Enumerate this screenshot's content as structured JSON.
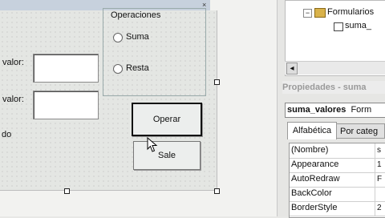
{
  "designer": {
    "close_glyph": "×",
    "frame_title": "Operaciones",
    "radio_suma": "Suma",
    "radio_resta": "Resta",
    "label_valor1": "valor:",
    "label_valor2": "valor:",
    "label_resultado": "do",
    "button_operar": "Operar",
    "button_salir": "Sale"
  },
  "project_tree": {
    "folder_label": "Formularios",
    "form_label": "suma_",
    "scroll_left": "◂"
  },
  "properties": {
    "panel_title": "Propiedades - suma",
    "object_name": "suma_valores",
    "object_type": "Form",
    "tab_alpha": "Alfabética",
    "tab_category": "Por categ",
    "rows": [
      {
        "name": "(Nombre)",
        "value": "s"
      },
      {
        "name": "Appearance",
        "value": "1"
      },
      {
        "name": "AutoRedraw",
        "value": "F"
      },
      {
        "name": "BackColor",
        "value": ""
      },
      {
        "name": "BorderStyle",
        "value": "2"
      }
    ]
  }
}
